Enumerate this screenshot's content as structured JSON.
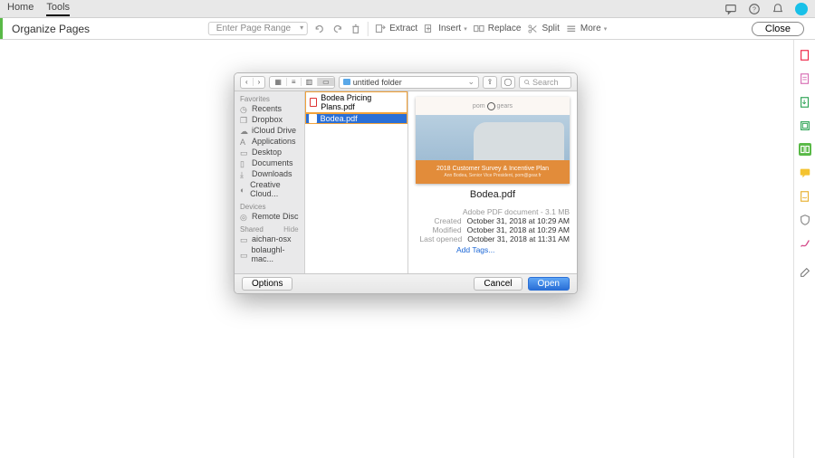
{
  "topbar": {
    "tabs": [
      "Home",
      "Tools"
    ],
    "active_tab_index": 1
  },
  "subbar": {
    "title": "Organize Pages",
    "page_range_placeholder": "Enter Page Range",
    "tools": {
      "extract": "Extract",
      "insert": "Insert",
      "replace": "Replace",
      "split": "Split",
      "more": "More"
    },
    "close": "Close"
  },
  "dialog": {
    "location": "untitled folder",
    "search_placeholder": "Search",
    "sidebar": {
      "favorites_label": "Favorites",
      "favorites": [
        "Recents",
        "Dropbox",
        "iCloud Drive",
        "Applications",
        "Desktop",
        "Documents",
        "Downloads",
        "Creative Cloud..."
      ],
      "devices_label": "Devices",
      "devices": [
        "Remote Disc"
      ],
      "shared_label": "Shared",
      "shared_hide": "Hide",
      "shared": [
        "aichan-osx",
        "bolaughl-mac..."
      ]
    },
    "files": [
      {
        "name": "Bodea Pricing Plans.pdf",
        "selected": false
      },
      {
        "name": "Bodea.pdf",
        "selected": true
      }
    ],
    "preview": {
      "brand_left": "pom",
      "brand_right": "gears",
      "band_title": "2018 Customer Survey & Incentive Plan",
      "band_sub": "Ann Bodea, Senior Vice President, pom@gear.fr",
      "filename": "Bodea.pdf",
      "doc_type": "Adobe PDF document - 3.1 MB",
      "created_k": "Created",
      "created_v": "October 31, 2018 at 10:29 AM",
      "modified_k": "Modified",
      "modified_v": "October 31, 2018 at 10:29 AM",
      "opened_k": "Last opened",
      "opened_v": "October 31, 2018 at 11:31 AM",
      "add_tags": "Add Tags..."
    },
    "footer": {
      "options": "Options",
      "cancel": "Cancel",
      "open": "Open"
    }
  }
}
